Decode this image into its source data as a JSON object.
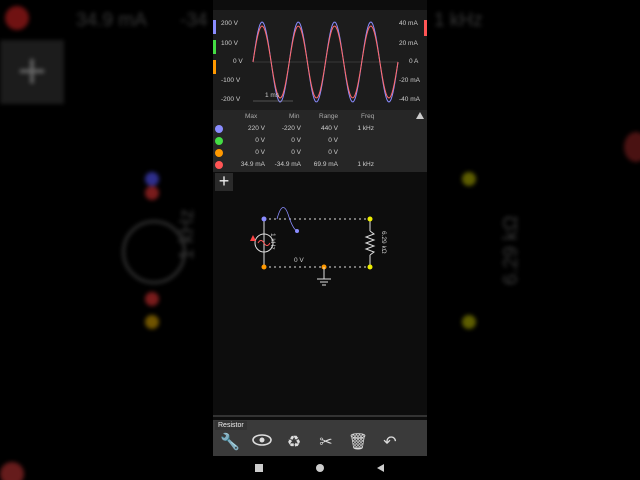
{
  "background": {
    "current_readout": "34.9 mA",
    "current_min_partial": "-34",
    "freq_readout_bg": "1 kHz",
    "resistor_bg_label": "6.29 kΩ",
    "source_bg_label": "1 kHz"
  },
  "scope": {
    "left_axis": [
      "200 V",
      "100 V",
      "0 V",
      "-100 V",
      "-200 V"
    ],
    "right_axis": [
      "40 mA",
      "20 mA",
      "0 A",
      "-20 mA",
      "-40 mA"
    ],
    "time_label": "1 ms",
    "colors": {
      "voltage": "#8a8cff",
      "current": "#ff6a6a",
      "green": "#44dd44",
      "orange": "#ff9900"
    }
  },
  "table": {
    "headers": [
      "Max",
      "Min",
      "Range",
      "Freq"
    ],
    "rows": [
      {
        "color": "#8a8cff",
        "values": [
          "220 V",
          "-220 V",
          "440 V",
          "1 kHz"
        ]
      },
      {
        "color": "#44dd44",
        "values": [
          "0 V",
          "0 V",
          "0 V",
          ""
        ]
      },
      {
        "color": "#ff9900",
        "values": [
          "0 V",
          "0 V",
          "0 V",
          ""
        ]
      },
      {
        "color": "#ff5555",
        "values": [
          "34.9 mA",
          "-34.9 mA",
          "69.9 mA",
          "1 kHz"
        ]
      }
    ]
  },
  "circuit": {
    "source_label": "1 kHz",
    "resistor_label": "6.29 kΩ",
    "wire_label": "0 V"
  },
  "toolbar": {
    "title": "Resistor",
    "tools": [
      "wrench-icon",
      "eye-icon",
      "recycle-icon",
      "scissors-icon",
      "trash-icon",
      "undo-icon"
    ]
  },
  "nav": {
    "icons": [
      "square-nav-icon",
      "circle-nav-icon",
      "triangle-back-icon"
    ]
  }
}
